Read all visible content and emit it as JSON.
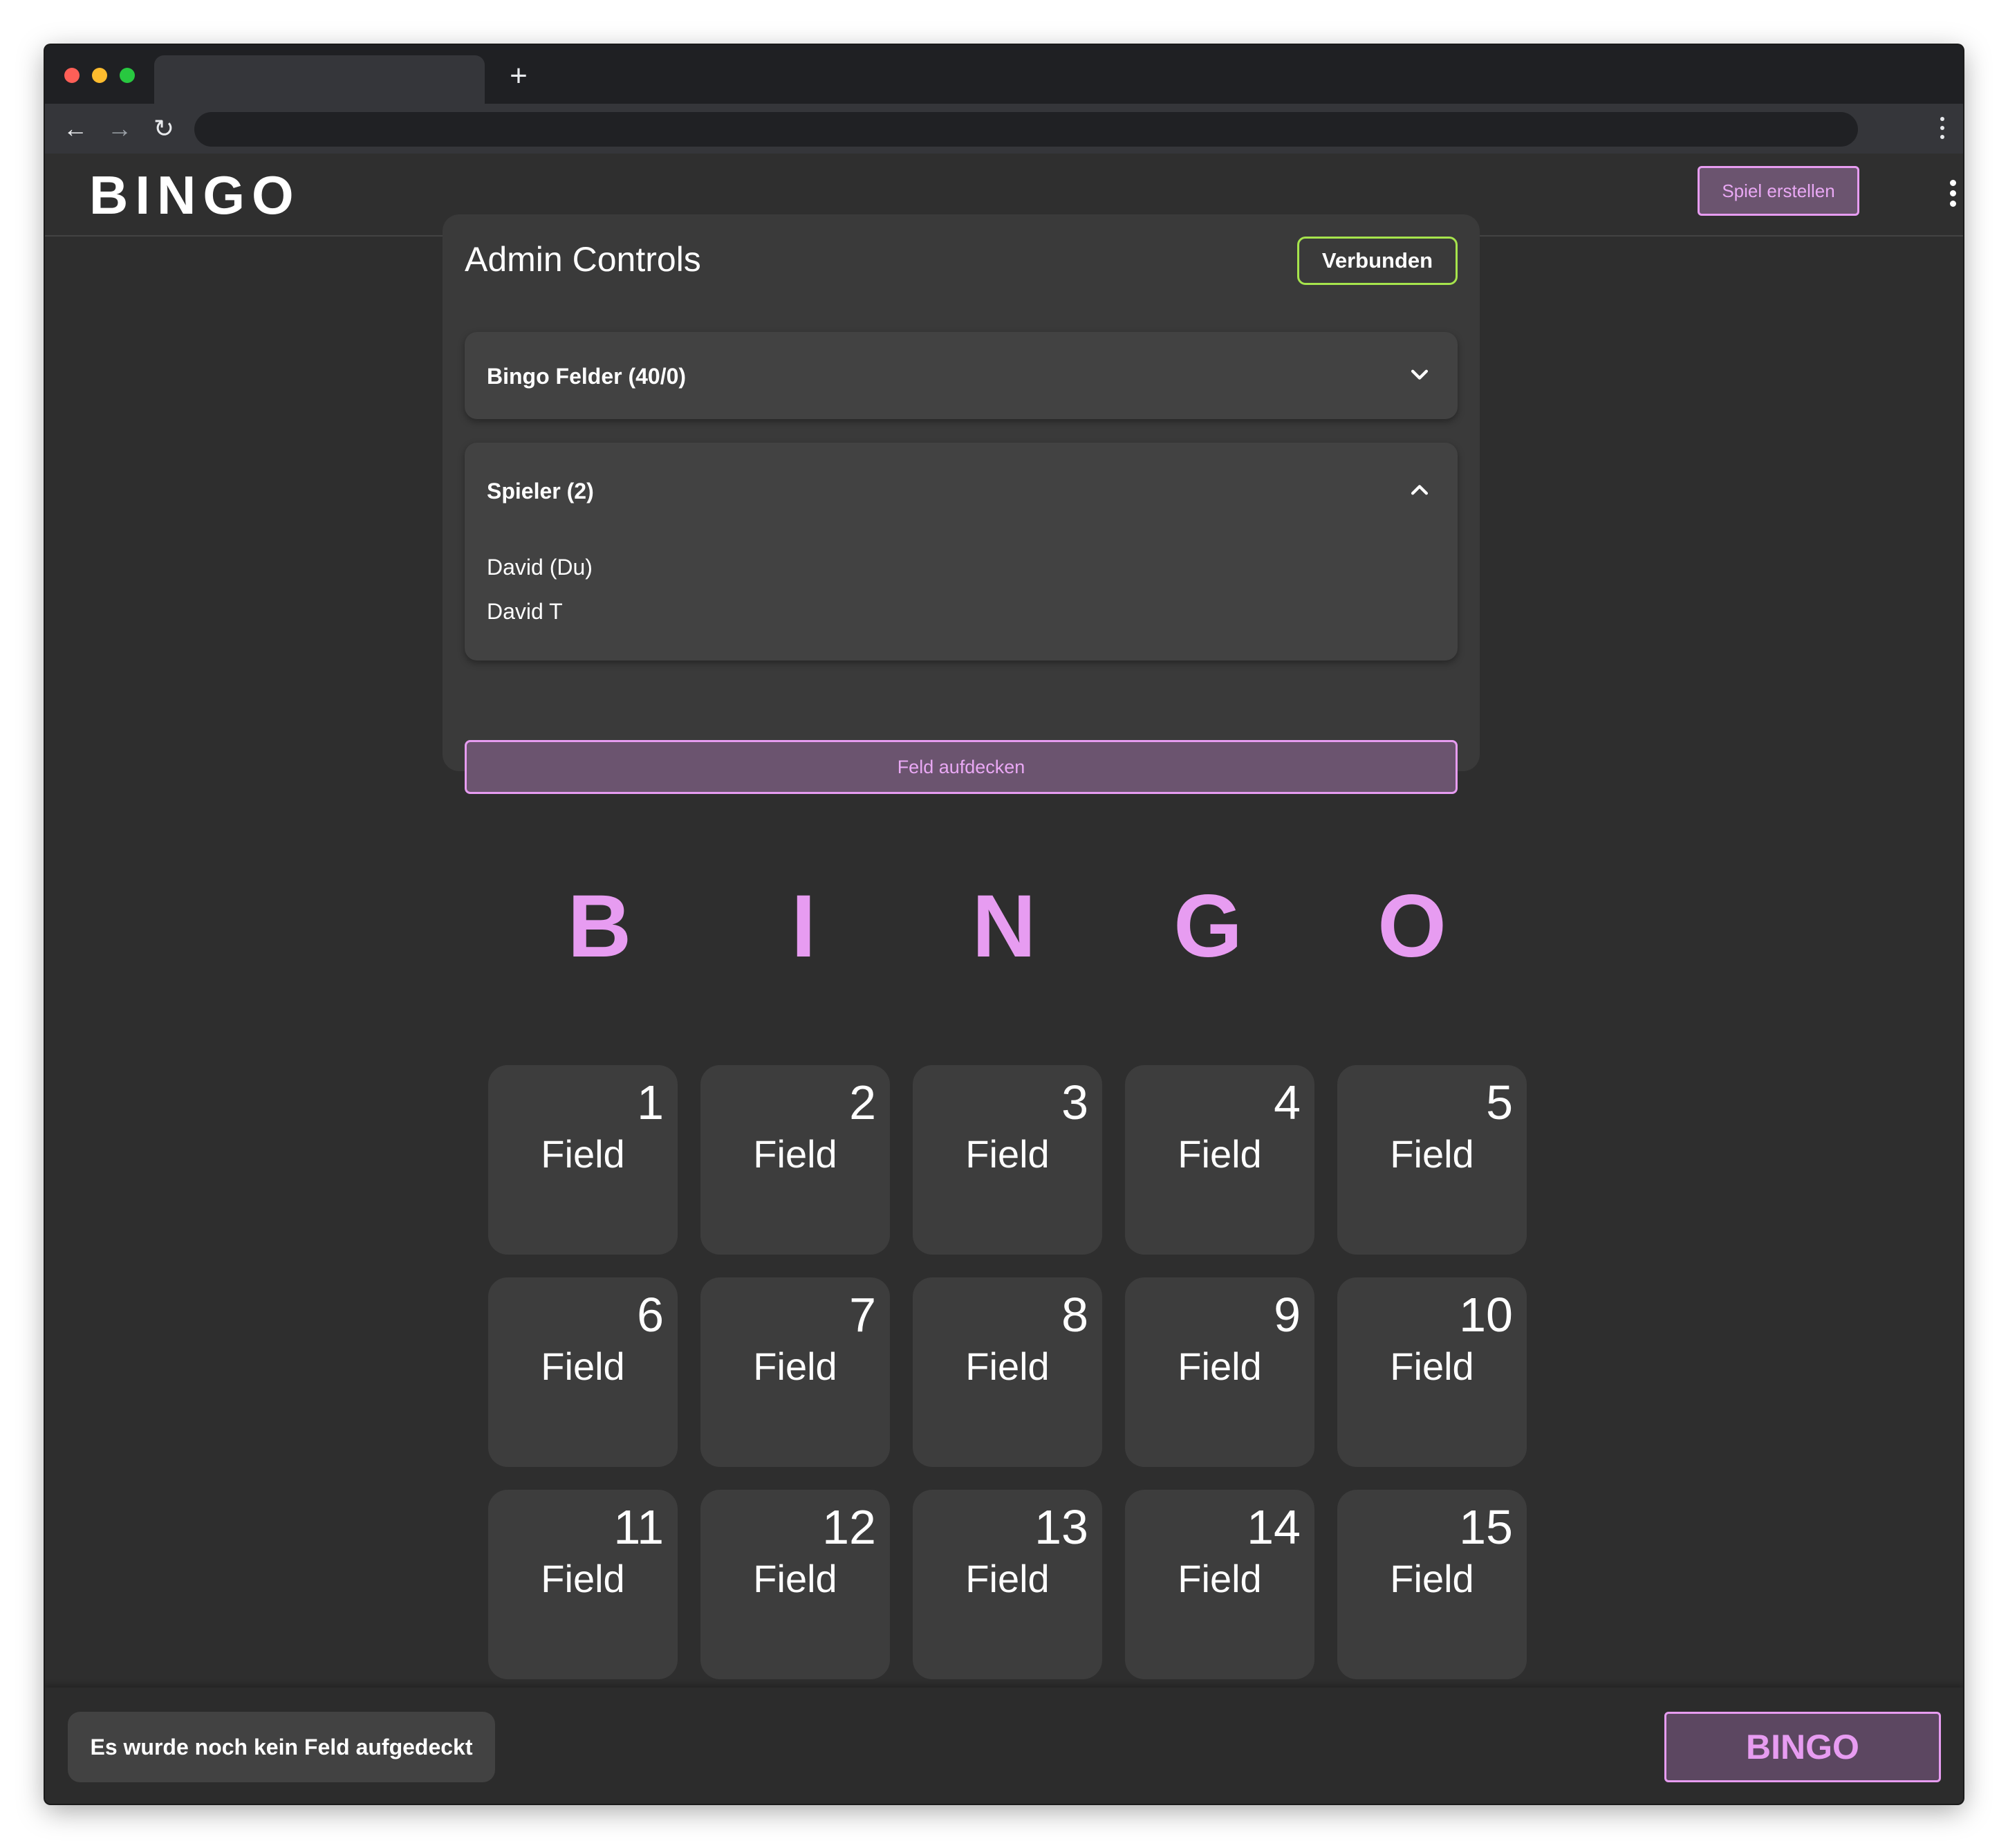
{
  "browser": {
    "new_tab_glyph": "+",
    "back_glyph": "←",
    "forward_glyph": "→",
    "reload_glyph": "↻"
  },
  "header": {
    "brand": "BINGO",
    "create_game_label": "Spiel erstellen"
  },
  "admin": {
    "title": "Admin Controls",
    "status_label": "Verbunden",
    "fields_section": {
      "label": "Bingo Felder (40/0)",
      "expanded": false
    },
    "players_section": {
      "label": "Spieler (2)",
      "expanded": true,
      "players": [
        "David (Du)",
        "David T"
      ]
    },
    "reveal_button_label": "Feld aufdecken"
  },
  "board": {
    "letters": [
      "B",
      "I",
      "N",
      "G",
      "O"
    ],
    "cells": [
      {
        "number": "1",
        "label": "Field"
      },
      {
        "number": "2",
        "label": "Field"
      },
      {
        "number": "3",
        "label": "Field"
      },
      {
        "number": "4",
        "label": "Field"
      },
      {
        "number": "5",
        "label": "Field"
      },
      {
        "number": "6",
        "label": "Field"
      },
      {
        "number": "7",
        "label": "Field"
      },
      {
        "number": "8",
        "label": "Field"
      },
      {
        "number": "9",
        "label": "Field"
      },
      {
        "number": "10",
        "label": "Field"
      },
      {
        "number": "11",
        "label": "Field"
      },
      {
        "number": "12",
        "label": "Field"
      },
      {
        "number": "13",
        "label": "Field"
      },
      {
        "number": "14",
        "label": "Field"
      },
      {
        "number": "15",
        "label": "Field"
      }
    ]
  },
  "footer": {
    "status_message": "Es wurde noch kein Feld aufgedeckt",
    "bingo_button_label": "BINGO"
  },
  "colors": {
    "accent": "#e79cf1",
    "connected": "#a6e44c",
    "background": "#2e2e2e",
    "card": "#3d3d3d"
  }
}
